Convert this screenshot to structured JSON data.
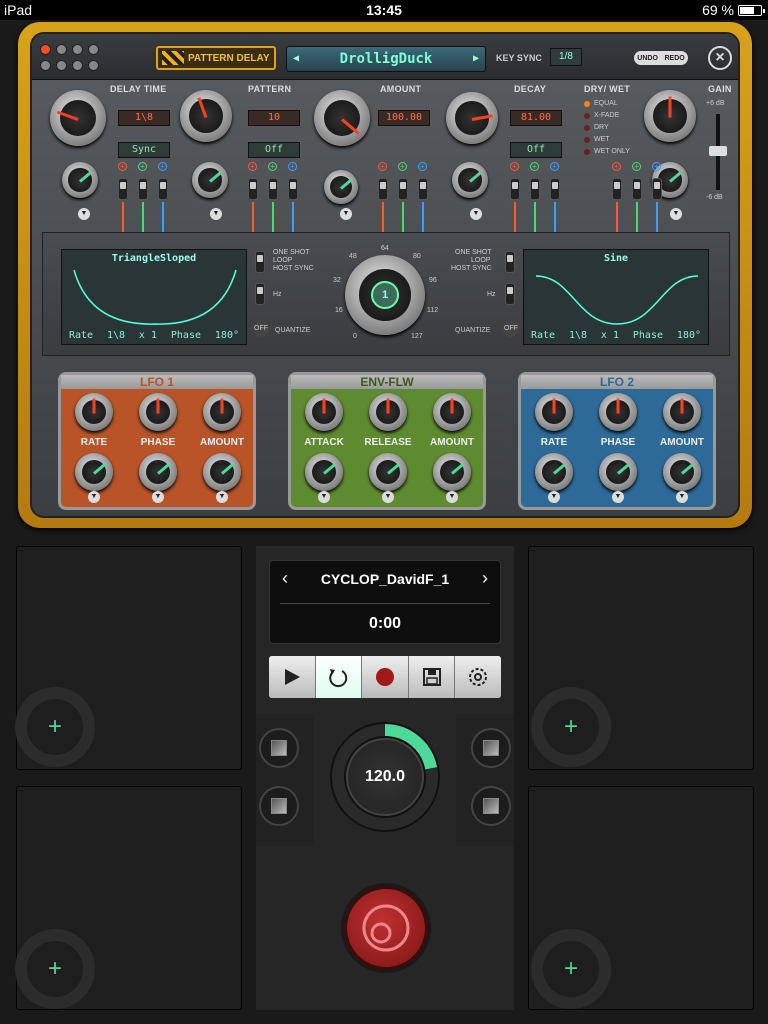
{
  "status": {
    "device": "iPad",
    "time": "13:45",
    "battery": "69 %"
  },
  "plugin": {
    "effect_name": "PATTERN DELAY",
    "preset_name": "DrolligDuck",
    "key_sync_label": "KEY SYNC",
    "key_sync_value": "1/8",
    "undo": "UNDO",
    "redo": "REDO",
    "sections": {
      "delay_time": {
        "label": "DELAY TIME",
        "value": "1\\8",
        "mode": "Sync"
      },
      "pattern": {
        "label": "PATTERN",
        "value": "10",
        "mode": "Off"
      },
      "amount": {
        "label": "AMOUNT",
        "value": "100.00"
      },
      "decay": {
        "label": "DECAY",
        "value": "81.00",
        "mode": "Off"
      },
      "drywet": {
        "label": "DRY/ WET",
        "options": [
          "EQUAL",
          "X-FADE",
          "DRY",
          "WET",
          "WET ONLY"
        ]
      },
      "gain": {
        "label": "GAIN",
        "top": "+6 dB",
        "bottom": "-6 dB"
      }
    },
    "lfo_left": {
      "shape": "TriangleSloped",
      "rate_label": "Rate",
      "rate": "1\\8",
      "mult": "x 1",
      "phase_label": "Phase",
      "phase": "180°"
    },
    "lfo_right": {
      "shape": "Sine",
      "rate_label": "Rate",
      "rate": "1\\8",
      "mult": "x 1",
      "phase_label": "Phase",
      "phase": "180°"
    },
    "modes": {
      "one_shot": "ONE SHOT",
      "loop": "LOOP",
      "host_sync": "HOST SYNC",
      "hz": "Hz",
      "quantize": "QUANTIZE",
      "off": "OFF"
    },
    "center_knob": {
      "value": "1",
      "scale": [
        "0",
        "16",
        "32",
        "48",
        "64",
        "80",
        "96",
        "112",
        "127"
      ]
    },
    "modules": [
      {
        "title": "LFO 1",
        "color": "#b85428",
        "labels": [
          "RATE",
          "PHASE",
          "AMOUNT"
        ]
      },
      {
        "title": "ENV-FLW",
        "color": "#5e8a30",
        "labels": [
          "ATTACK",
          "RELEASE",
          "AMOUNT"
        ]
      },
      {
        "title": "LFO 2",
        "color": "#2e6a98",
        "labels": [
          "RATE",
          "PHASE",
          "AMOUNT"
        ]
      }
    ]
  },
  "player": {
    "song_name": "CYCLOP_DavidF_1",
    "time": "0:00",
    "tempo": "120.0",
    "tempo_progress": 0.22
  },
  "colors": {
    "accent": "#4dd99a",
    "frame": "#d8a21a",
    "record": "#a02020"
  }
}
